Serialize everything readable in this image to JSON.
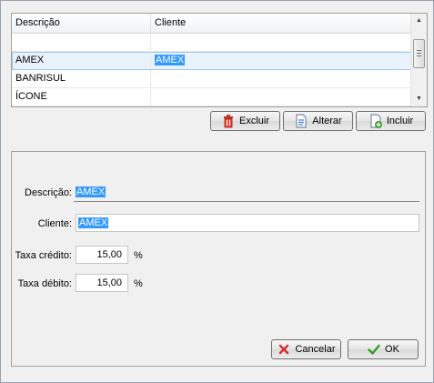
{
  "grid": {
    "columns": [
      "Descrição",
      "Cliente"
    ],
    "rows": [
      {
        "descricao": "",
        "cliente": ""
      },
      {
        "descricao": "AMEX",
        "cliente": "AMEX"
      },
      {
        "descricao": "BANRISUL",
        "cliente": ""
      },
      {
        "descricao": "ÍCONE",
        "cliente": ""
      }
    ],
    "selected_row": 1
  },
  "actions": {
    "excluir": "Excluir",
    "alterar": "Alterar",
    "incluir": "Incluir"
  },
  "form": {
    "descricao_label": "Descrição:",
    "descricao_value": "AMEX",
    "cliente_label": "Cliente:",
    "cliente_value": "AMEX",
    "taxa_credito_label": "Taxa crédito:",
    "taxa_credito_value": "15,00",
    "taxa_debito_label": "Taxa débito:",
    "taxa_debito_value": "15,00",
    "percent": "%"
  },
  "dialog": {
    "cancelar": "Cancelar",
    "ok": "OK"
  },
  "colors": {
    "selection": "#3399ff",
    "delete_icon": "#c0392b",
    "cancel_icon": "#d32f2f",
    "ok_icon": "#3c9a2f"
  }
}
